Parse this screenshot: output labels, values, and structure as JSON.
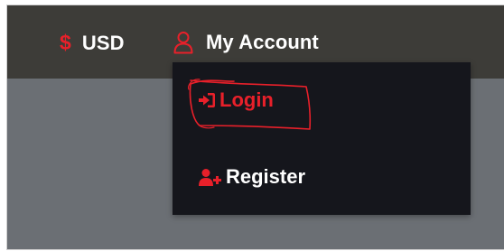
{
  "header": {
    "currency": {
      "symbol": "$",
      "label": "USD"
    },
    "account": {
      "label": "My Account",
      "icon": "user-icon"
    }
  },
  "dropdown": {
    "items": [
      {
        "label": "Login",
        "icon": "login-icon",
        "highlighted": true
      },
      {
        "label": "Register",
        "icon": "user-plus-icon"
      }
    ]
  },
  "colors": {
    "accent": "#e8202a",
    "header_bg": "#3d3c38",
    "dropdown_bg": "#15161c",
    "page_bg": "#6b6f74"
  }
}
